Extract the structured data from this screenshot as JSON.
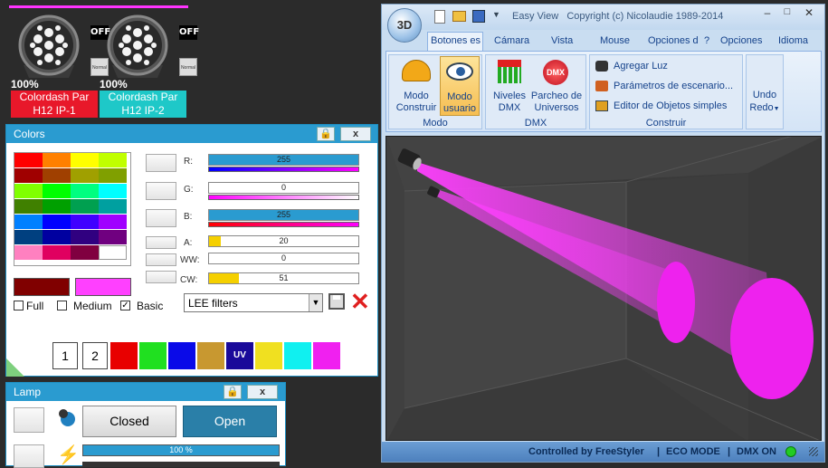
{
  "fixtures": [
    {
      "name_line1": "Colordash Par",
      "name_line2": "H12 IP-1",
      "percent": "100%",
      "status": "OFF",
      "mode": "Normal",
      "color": "#e8182a"
    },
    {
      "name_line1": "Colordash Par",
      "name_line2": "H12 IP-2",
      "percent": "100%",
      "status": "OFF",
      "mode": "Normal",
      "color": "#1ec8c8"
    }
  ],
  "colors_panel": {
    "title": "Colors",
    "close": "x",
    "palette": [
      [
        "#ff0000",
        "#ff8000",
        "#ffff00",
        "#c0ff00"
      ],
      [
        "#a00000",
        "#a04000",
        "#a0a000",
        "#80a000"
      ],
      [
        "#80ff00",
        "#00ff00",
        "#00ff80",
        "#00ffff"
      ],
      [
        "#408000",
        "#00a000",
        "#00a050",
        "#00a0a0"
      ],
      [
        "#0080ff",
        "#0000ff",
        "#4000ff",
        "#a000ff"
      ],
      [
        "#004080",
        "#0000a0",
        "#300080",
        "#700080"
      ],
      [
        "#ff80c0",
        "#e00060",
        "#800040",
        "#ffffff"
      ]
    ],
    "current_color": "#800000",
    "preview_color": "#ff40ff",
    "channels": [
      {
        "label": "R:",
        "value": "255",
        "level": 1.0,
        "fill": "#2a9bd0",
        "strip": "linear-gradient(90deg,#0000ff,#ff00ff)"
      },
      {
        "label": "G:",
        "value": "0",
        "level": 0.0,
        "fill": "#2a9bd0",
        "strip": "linear-gradient(90deg,#ff00ff,#ffffff)"
      },
      {
        "label": "B:",
        "value": "255",
        "level": 1.0,
        "fill": "#2a9bd0",
        "strip": "linear-gradient(90deg,#ff0000,#ff00ff)"
      },
      {
        "label": "A:",
        "value": "20",
        "level": 0.08,
        "fill": "#f5d000"
      },
      {
        "label": "WW:",
        "value": "0",
        "level": 0.0,
        "fill": "#f5d000"
      },
      {
        "label": "CW:",
        "value": "51",
        "level": 0.2,
        "fill": "#f5d000"
      }
    ],
    "filter_select": "LEE filters",
    "options": [
      {
        "label": "Full",
        "checked": false
      },
      {
        "label": "Medium",
        "checked": false
      },
      {
        "label": "Basic",
        "checked": true
      }
    ],
    "presets": [
      "1",
      "2"
    ],
    "preset_swatches": [
      {
        "color": "#e80000",
        "label": ""
      },
      {
        "color": "#20e020",
        "label": ""
      },
      {
        "color": "#0a0ae8",
        "label": ""
      },
      {
        "color": "#c89830",
        "label": ""
      },
      {
        "color": "#1a0a9a",
        "label": "UV"
      },
      {
        "color": "#f0e020",
        "label": ""
      },
      {
        "color": "#10f0f0",
        "label": ""
      },
      {
        "color": "#f020f0",
        "label": ""
      }
    ]
  },
  "lamp_panel": {
    "title": "Lamp",
    "close": "x",
    "closed_label": "Closed",
    "open_label": "Open",
    "progress": "100 %",
    "progress_level": 1.0
  },
  "app": {
    "quick_title": "Easy View   Copyright (c) Nicolaudie 1989-2014",
    "tabs": [
      "Botones es",
      "Cámara",
      "Vista",
      "Mouse",
      "Opciones d",
      "?",
      "Opciones",
      "Idioma"
    ],
    "buttons": {
      "modo_construir": "Modo Construir",
      "modo_usuario": "Modo usuario",
      "niveles_dmx": "Niveles DMX",
      "parcheo": "Parcheo de Universos",
      "agregar_luz": "Agregar Luz",
      "parametros": "Parámetros de escenario...",
      "editor": "Editor de Objetos simples",
      "undo": "Undo",
      "redo": "Redo"
    },
    "groups": {
      "modo": "Modo",
      "dmx": "DMX",
      "construir": "Construir"
    },
    "status": {
      "controlled": "Controlled by FreeStyler",
      "eco": "ECO MODE",
      "dmx": "DMX ON",
      "dmx_color": "#22cc22"
    }
  }
}
